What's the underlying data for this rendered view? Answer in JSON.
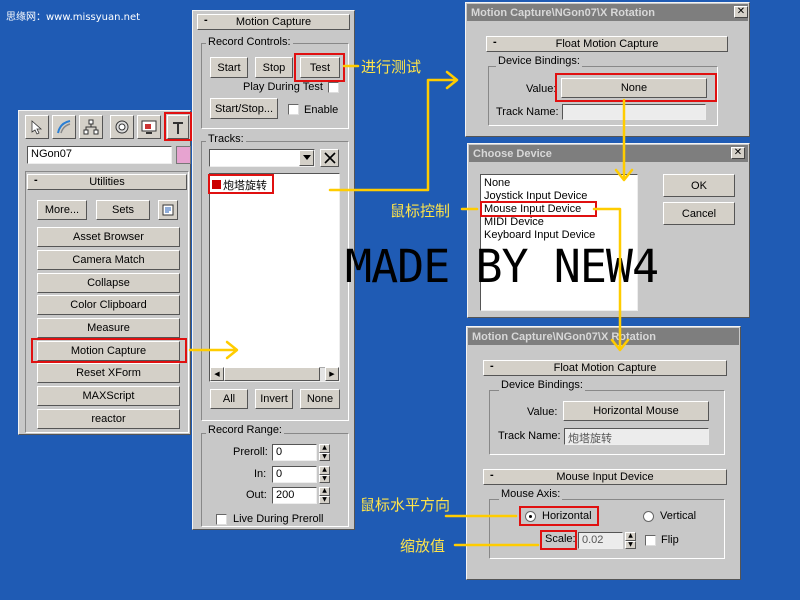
{
  "watermark": "思缘网：www.missyuan.net",
  "made_by": "MADE BY NEW4",
  "utilities": {
    "object_name": "NGon07",
    "rollout_title": "Utilities",
    "more_label": "More...",
    "sets_label": "Sets",
    "items": [
      "Asset Browser",
      "Camera Match",
      "Collapse",
      "Color Clipboard",
      "Measure",
      "Motion Capture",
      "Reset XForm",
      "MAXScript",
      "reactor"
    ]
  },
  "motion_capture": {
    "rollout_title": "Motion Capture",
    "record_controls_label": "Record Controls:",
    "start_label": "Start",
    "stop_label": "Stop",
    "test_label": "Test",
    "play_during_test": "Play During Test",
    "start_stop_label": "Start/Stop...",
    "enable_label": "Enable",
    "tracks_label": "Tracks:",
    "track_item": "炮塔旋转",
    "all_label": "All",
    "invert_label": "Invert",
    "none_label": "None",
    "record_range_label": "Record Range:",
    "preroll_label": "Preroll:",
    "preroll_value": "0",
    "in_label": "In:",
    "in_value": "0",
    "out_label": "Out:",
    "out_value": "200",
    "live_during_preroll": "Live During Preroll"
  },
  "float_dialog_1": {
    "title": "Motion Capture\\NGon07\\X Rotation",
    "rollout_title": "Float Motion Capture",
    "device_bindings": "Device Bindings:",
    "value_label": "Value:",
    "value_button": "None",
    "track_name_label": "Track Name:",
    "track_name_value": ""
  },
  "choose_device": {
    "title": "Choose Device",
    "items": [
      "None",
      "Joystick Input Device",
      "Mouse Input Device",
      "MIDI Device",
      "Keyboard Input Device"
    ],
    "ok_label": "OK",
    "cancel_label": "Cancel"
  },
  "float_dialog_2": {
    "title": "Motion Capture\\NGon07\\X Rotation",
    "rollout_title": "Float Motion Capture",
    "device_bindings": "Device Bindings:",
    "value_label": "Value:",
    "value_button": "Horizontal Mouse",
    "track_name_label": "Track Name:",
    "track_name_value": "炮塔旋转",
    "mouse_rollout_title": "Mouse Input Device",
    "mouse_axis_label": "Mouse Axis:",
    "horizontal_label": "Horizontal",
    "vertical_label": "Vertical",
    "scale_label": "Scale:",
    "scale_value": "0.02",
    "flip_label": "Flip"
  },
  "annotations": {
    "test": "进行测试",
    "mouse_control": "鼠标控制",
    "horizontal_dir": "鼠标水平方向",
    "scale_value": "缩放值"
  },
  "colors": {
    "background": "#1f5bb4",
    "annotation": "#ffe44a",
    "highlight": "#e01010",
    "panel": "#c8c8c8"
  }
}
